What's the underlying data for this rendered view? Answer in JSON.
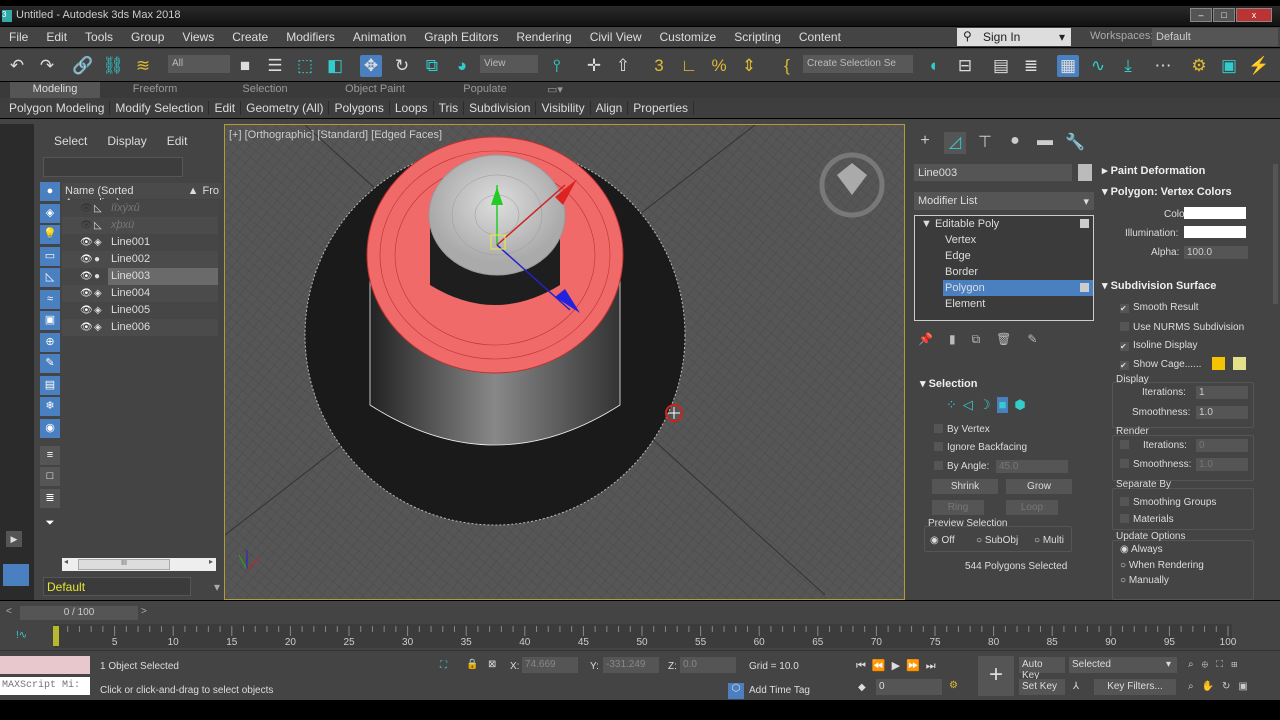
{
  "window": {
    "title": "Untitled - Autodesk 3ds Max 2018",
    "app_icon": "3"
  },
  "menu": [
    "File",
    "Edit",
    "Tools",
    "Group",
    "Views",
    "Create",
    "Modifiers",
    "Animation",
    "Graph Editors",
    "Rendering",
    "Civil View",
    "Customize",
    "Scripting",
    "Content"
  ],
  "account": {
    "sign_in": "Sign In",
    "workspaces_label": "Workspaces:",
    "workspace": "Default"
  },
  "toolbar": {
    "selection_filter": "All",
    "ref_coord": "View",
    "named_selection": "Create Selection Se"
  },
  "ribbon": {
    "tabs": [
      "Modeling",
      "Freeform",
      "Selection",
      "Object Paint",
      "Populate"
    ],
    "panels": [
      "Polygon Modeling",
      "Modify Selection",
      "Edit",
      "Geometry (All)",
      "Polygons",
      "Loops",
      "Tris",
      "Subdivision",
      "Visibility",
      "Align",
      "Properties"
    ]
  },
  "explorer": {
    "tabs": [
      "Select",
      "Display",
      "Edit"
    ],
    "column_name": "Name (Sorted Ascending)",
    "column_from": "Fro",
    "rows": [
      {
        "name": "ïïxýxû",
        "hidden": true
      },
      {
        "name": "xþxü",
        "hidden": true
      },
      {
        "name": "Line001"
      },
      {
        "name": "Line002"
      },
      {
        "name": "Line003",
        "selected": true
      },
      {
        "name": "Line004"
      },
      {
        "name": "Line005"
      },
      {
        "name": "Line006"
      }
    ],
    "layer": "Default",
    "scroll_thumb": "III"
  },
  "viewport": {
    "label": "[+] [Orthographic] [Standard] [Edged Faces]",
    "selection_color": "#f06060"
  },
  "command_panel": {
    "object_name": "Line003",
    "modifier_list": "Modifier List",
    "stack": {
      "root": "Editable Poly",
      "items": [
        "Vertex",
        "Edge",
        "Border",
        "Polygon",
        "Element"
      ],
      "active": "Polygon"
    },
    "selection": {
      "title": "Selection",
      "by_vertex": "By Vertex",
      "ignore_backfacing": "Ignore Backfacing",
      "by_angle": "By Angle:",
      "angle": "45.0",
      "shrink": "Shrink",
      "grow": "Grow",
      "ring": "Ring",
      "loop": "Loop",
      "preview_title": "Preview Selection",
      "preview_options": [
        "Off",
        "SubObj",
        "Multi"
      ],
      "status": "544 Polygons Selected"
    },
    "paint_deformation": "Paint Deformation",
    "vertex_colors": {
      "title": "Polygon: Vertex Colors",
      "color": "Color:",
      "illumination": "Illumination:",
      "alpha": "Alpha:",
      "alpha_value": "100.0"
    },
    "subdivision": {
      "title": "Subdivision Surface",
      "smooth_result": "Smooth Result",
      "use_nurms": "Use NURMS Subdivision",
      "isoline": "Isoline Display",
      "show_cage": "Show Cage......",
      "display": "Display",
      "iterations": "Iterations:",
      "smoothness": "Smoothness:",
      "disp_iter": "1",
      "disp_smooth": "1.0",
      "render": "Render",
      "rend_iter": "0",
      "rend_smooth": "1.0",
      "separate_by": "Separate By",
      "smoothing_groups": "Smoothing Groups",
      "materials": "Materials",
      "update_options": "Update Options",
      "always": "Always",
      "when_rendering": "When Rendering",
      "manually": "Manually",
      "cage_colors": [
        "#f5c400",
        "#e6e08a"
      ]
    }
  },
  "timeline": {
    "frame": "0 / 100",
    "ticks": [
      "5",
      "10",
      "15",
      "20",
      "25",
      "30",
      "35",
      "40",
      "45",
      "50",
      "55",
      "60",
      "65",
      "70",
      "75",
      "80",
      "85",
      "90",
      "95",
      "100"
    ],
    "current": "0"
  },
  "status": {
    "maxscript": "MAXScript Mi:",
    "objects": "1 Object Selected",
    "prompt": "Click or click-and-drag to select objects",
    "x_label": "X:",
    "x": "74.669",
    "y_label": "Y:",
    "y": "-331.249",
    "z_label": "Z:",
    "z": "0.0",
    "grid": "Grid = 10.0",
    "add_time_tag": "Add Time Tag",
    "auto_key": "Auto Key",
    "set_key": "Set Key",
    "key_mode": "Selected",
    "key_filters": "Key Filters...",
    "frame_field": "0"
  }
}
